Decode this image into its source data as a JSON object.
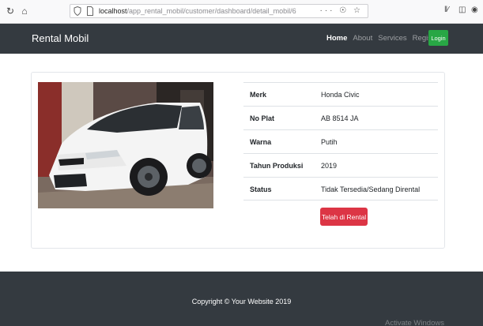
{
  "browser": {
    "url_host": "localhost",
    "url_path": "/app_rental_mobil/customer/dashboard/detail_mobil/6",
    "url_actions": "··· ☉ ☆"
  },
  "navbar": {
    "brand": "Rental Mobil",
    "links": [
      "Home",
      "About",
      "Services",
      "Register"
    ],
    "login_label": "Login"
  },
  "car": {
    "image_icon": "car-photo",
    "specs": [
      {
        "label": "Merk",
        "value": "Honda Civic"
      },
      {
        "label": "No Plat",
        "value": "AB 8514 JA"
      },
      {
        "label": "Warna",
        "value": "Putih"
      },
      {
        "label": "Tahun Produksi",
        "value": "2019"
      },
      {
        "label": "Status",
        "value": "Tidak Tersedia/Sedang Dirental"
      }
    ],
    "rent_button_label": "Telah di Rental"
  },
  "footer": {
    "copyright": "Copyright © Your Website 2019",
    "watermark": "Activate Windows"
  },
  "colors": {
    "navbar": "#343a40",
    "login": "#28a745",
    "rent": "#dc3545"
  }
}
